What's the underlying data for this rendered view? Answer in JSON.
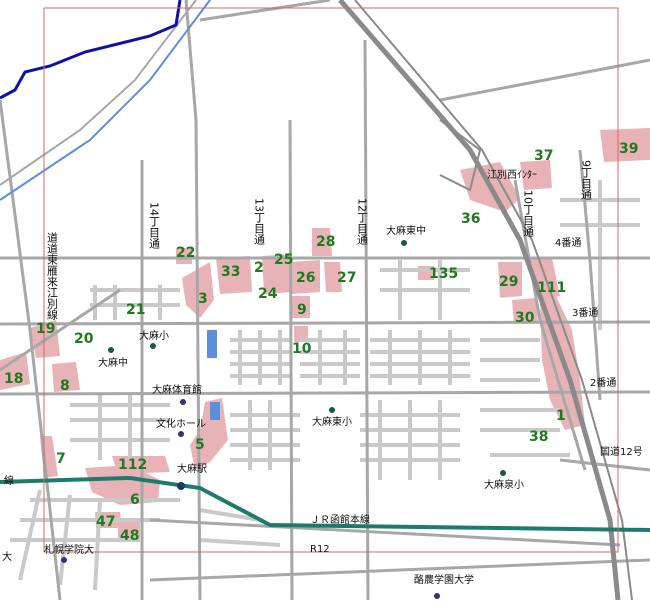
{
  "map": {
    "colors": {
      "background": "#ffffff",
      "road": "#a7a7a7",
      "block_road": "#c9c9c9",
      "expressway": "#8a8a8a",
      "rail": "#1d7a6e",
      "boundary": "#1010a8",
      "river": "#5b8fdc",
      "highlight_area": "#e8b3b6",
      "frame": "#d46a6a",
      "number": "#1f7a1f",
      "facility_dot": "#145c3a",
      "school_dot": "#33337a"
    },
    "streets": {
      "ch14": "14丁目通",
      "ch13": "13丁目通",
      "ch12": "12丁目通",
      "ch10": "10丁目通",
      "ch9": "9丁目通",
      "dodo": "道道東雁来江別線",
      "ban4": "4番通",
      "ban3": "3番通",
      "ban2": "2番通",
      "kokudo": "国道12号",
      "jr": "ＪＲ函館本線",
      "r12": "R12",
      "ic": "江別西ｲﾝﾀｰ",
      "sen_left": "線"
    },
    "facilities": {
      "oasa_higashi_chu": "大麻東中",
      "oasa_sho": "大麻小",
      "oasa_chu": "大麻中",
      "oasa_taiikukan": "大麻体育館",
      "bunka_hall": "文化ホール",
      "oasa_eki": "大麻駅",
      "oasa_higashi_sho": "大麻東小",
      "oasa_izumi_sho": "大麻泉小",
      "sapporo_gakuin": "札幌学院大",
      "rakuno_gakuen": "酪農学園大学",
      "dai_left": "大"
    },
    "area_numbers": {
      "n1": "1",
      "n2": "2",
      "n3": "3",
      "n5": "5",
      "n6": "6",
      "n7": "7",
      "n8": "8",
      "n9": "9",
      "n10": "10",
      "n18": "18",
      "n19": "19",
      "n20": "20",
      "n21": "21",
      "n22": "22",
      "n24": "24",
      "n25": "25",
      "n26": "26",
      "n27": "27",
      "n28": "28",
      "n29": "29",
      "n30": "30",
      "n33": "33",
      "n36": "36",
      "n37": "37",
      "n38": "38",
      "n39": "39",
      "n47": "47",
      "n48": "48",
      "n111": "111",
      "n112": "112",
      "n135": "135"
    }
  }
}
